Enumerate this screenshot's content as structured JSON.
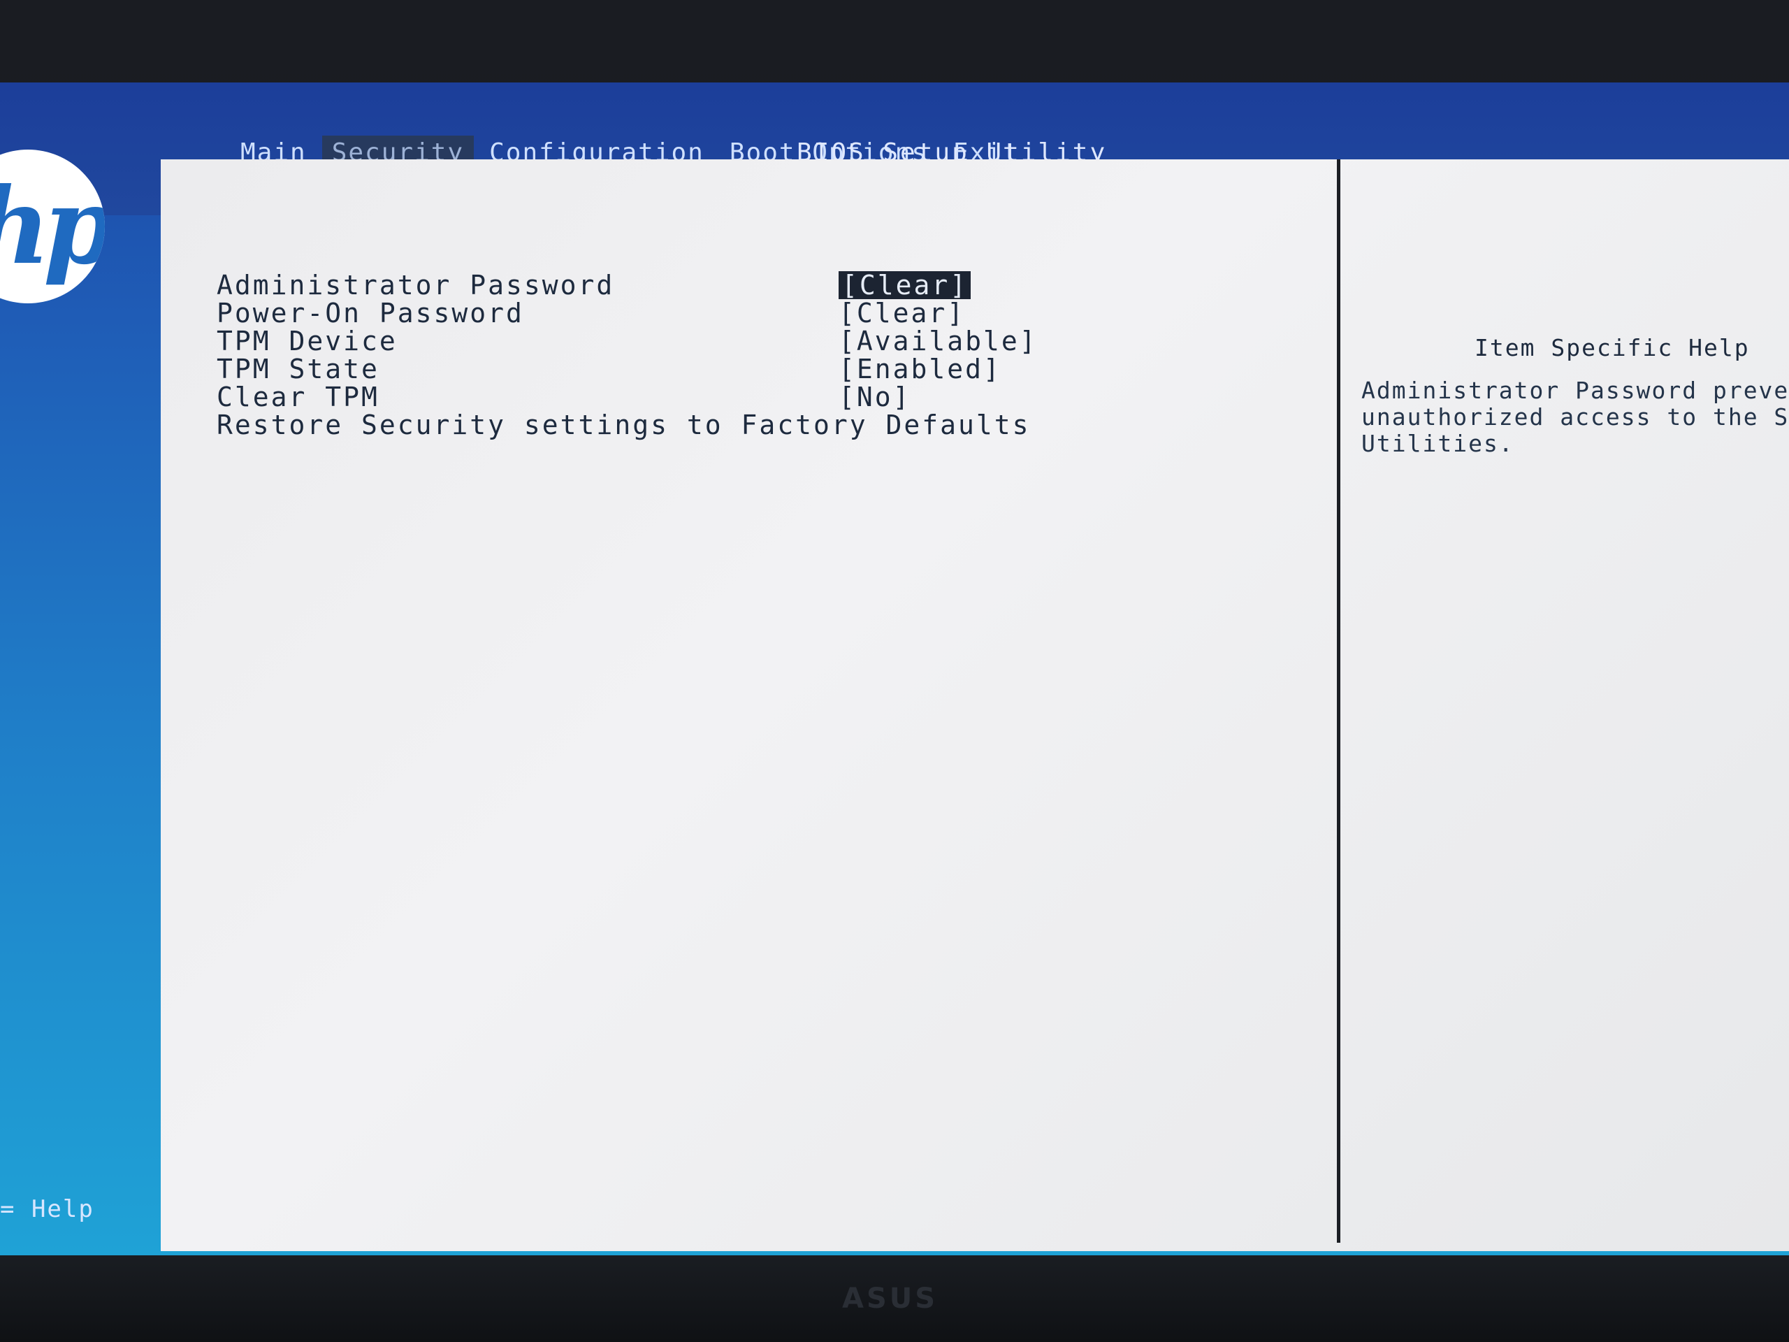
{
  "menu": {
    "items": [
      {
        "label": "Main"
      },
      {
        "label": "Security"
      },
      {
        "label": "Configuration"
      },
      {
        "label": "Boot Options"
      },
      {
        "label": "Exit"
      }
    ],
    "active_index": 1
  },
  "title": "BIOS Setup Utility",
  "logo_text": "hp",
  "settings": [
    {
      "label": "Administrator Password",
      "value": "[Clear]"
    },
    {
      "label": "Power-On Password",
      "value": "[Clear]"
    },
    {
      "label": "TPM Device",
      "value": "[Available]"
    },
    {
      "label": "TPM State",
      "value": "[Enabled]"
    },
    {
      "label": "Clear TPM",
      "value": "[No]"
    },
    {
      "label": "Restore Security settings to Factory Defaults",
      "value": ""
    }
  ],
  "help": {
    "title": "Item Specific Help",
    "lines": [
      "Administrator Password prevents",
      "unauthorized access to the Setu",
      "Utilities."
    ]
  },
  "footer": {
    "help_text": "= Help"
  },
  "bezel": {
    "brand": "ASUS"
  }
}
